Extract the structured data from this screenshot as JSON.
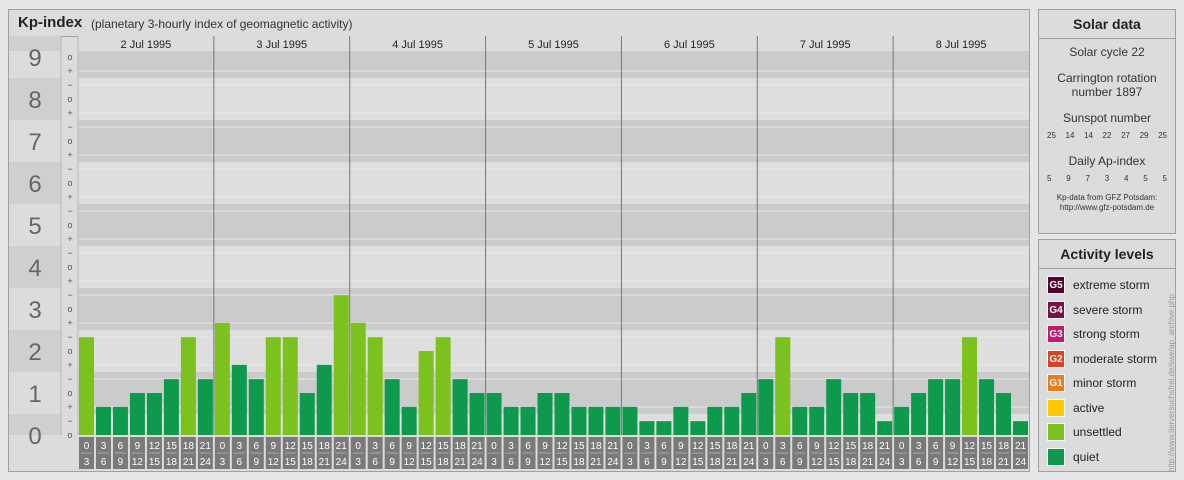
{
  "header": {
    "title": "Kp-index",
    "subtitle": "(planetary 3-hourly index of geomagnetic activity)"
  },
  "chart_data": {
    "type": "bar",
    "days": [
      "2 Jul 1995",
      "3 Jul 1995",
      "4 Jul 1995",
      "5 Jul 1995",
      "6 Jul 1995",
      "7 Jul 1995",
      "8 Jul 1995"
    ],
    "interval_start": [
      "0",
      "3",
      "6",
      "9",
      "12",
      "15",
      "18",
      "21"
    ],
    "interval_end": [
      "3",
      "6",
      "9",
      "12",
      "15",
      "18",
      "21",
      "24"
    ],
    "ylim": [
      0,
      9
    ],
    "y_ticks": [
      "0",
      "1",
      "2",
      "3",
      "4",
      "5",
      "6",
      "7",
      "8",
      "9"
    ],
    "sub_marks": [
      "+",
      "o",
      "−"
    ],
    "values": [
      2.33,
      0.67,
      0.67,
      1.0,
      1.0,
      1.33,
      2.33,
      1.33,
      2.67,
      1.67,
      1.33,
      2.33,
      2.33,
      1.0,
      1.67,
      3.33,
      2.67,
      2.33,
      1.33,
      0.67,
      2.0,
      2.33,
      1.33,
      1.0,
      1.0,
      0.67,
      0.67,
      1.0,
      1.0,
      0.67,
      0.67,
      0.67,
      0.67,
      0.33,
      0.33,
      0.67,
      0.33,
      0.67,
      0.67,
      1.0,
      1.33,
      2.33,
      0.67,
      0.67,
      1.33,
      1.0,
      1.0,
      0.33,
      0.67,
      1.0,
      1.33,
      1.33,
      2.33,
      1.33,
      1.0,
      0.33
    ],
    "colors": {
      "quiet": "#0e9a4c",
      "unsettled": "#7cc21e",
      "active": "#ffc800"
    }
  },
  "solar": {
    "title": "Solar data",
    "cycle": "Solar cycle 22",
    "carrington": "Carrington rotation number 1897",
    "sunspot_label": "Sunspot number",
    "sunspots": [
      "25",
      "14",
      "14",
      "22",
      "27",
      "29",
      "25"
    ],
    "ap_label": "Daily Ap-index",
    "ap": [
      "5",
      "9",
      "7",
      "3",
      "4",
      "5",
      "5"
    ],
    "credit_line1": "Kp-data from GFZ Potsdam:",
    "credit_line2": "http://www.gfz-potsdam.de"
  },
  "activity": {
    "title": "Activity levels",
    "items": [
      {
        "code": "G5",
        "label": "extreme storm",
        "color": "#5a0030"
      },
      {
        "code": "G4",
        "label": "severe storm",
        "color": "#7a1046"
      },
      {
        "code": "G3",
        "label": "strong storm",
        "color": "#c4186a"
      },
      {
        "code": "G2",
        "label": "moderate storm",
        "color": "#e04020"
      },
      {
        "code": "G1",
        "label": "minor storm",
        "color": "#f07a1a"
      },
      {
        "code": "",
        "label": "active",
        "color": "#ffc800"
      },
      {
        "code": "",
        "label": "unsettled",
        "color": "#7cc21e"
      },
      {
        "code": "",
        "label": "quiet",
        "color": "#0e9a4c"
      }
    ]
  },
  "watermark": "http://www.tierversuchsfrei.de/swe/ap_archive.php"
}
